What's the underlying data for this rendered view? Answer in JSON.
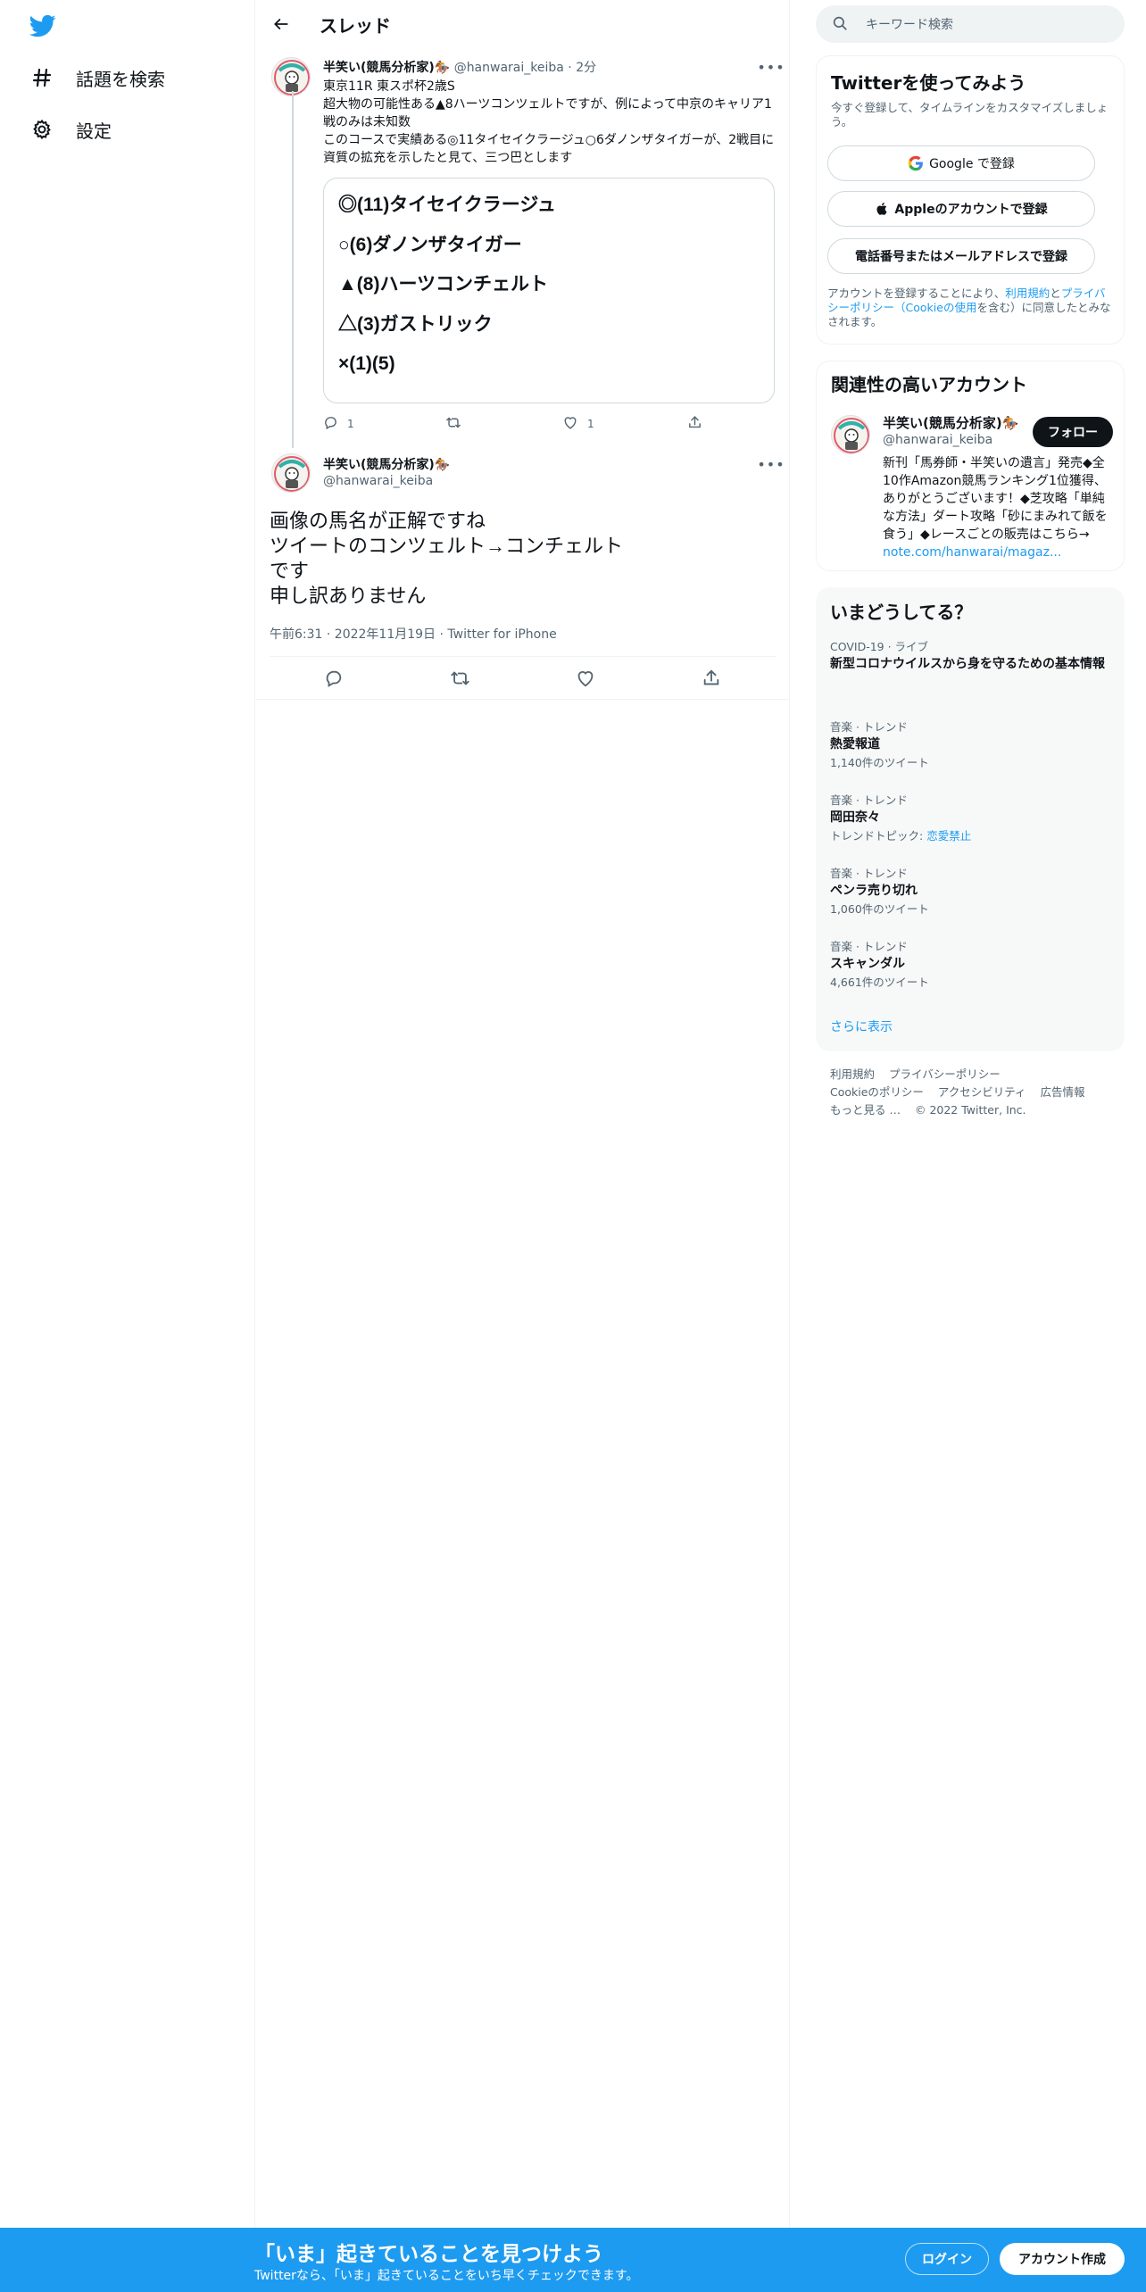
{
  "nav": {
    "explore_label": "話題を検索",
    "settings_label": "設定"
  },
  "thread": {
    "title": "スレッド",
    "tweet1": {
      "name": "半笑い(競馬分析家)🏇",
      "handle": "@hanwarai_keiba",
      "time": "· 2分",
      "text_lines": [
        "東京11R 東スポ杯2歳S",
        "超大物の可能性ある▲8ハーツコンツェルトですが、例によって中京のキャリア1戦のみは未知数",
        "このコースで実績ある◎11タイセイクラージュ○6ダノンザタイガーが、2戦目に資質の拡充を示したと見て、三つ巴とします"
      ],
      "card_lines": [
        "◎(11)タイセイクラージュ",
        "○(6)ダノンザタイガー",
        "▲(8)ハーツコンチェルト",
        "△(3)ガストリック",
        "×(1)(5)"
      ],
      "reply_count": "1",
      "like_count": "1"
    },
    "tweet2": {
      "name": "半笑い(競馬分析家)🏇",
      "handle": "@hanwarai_keiba",
      "text_lines": [
        "画像の馬名が正解ですね",
        "ツイートのコンツェルト→コンチェルト",
        "です",
        "申し訳ありません"
      ],
      "meta": "午前6:31 · 2022年11月19日 · Twitter for iPhone"
    }
  },
  "search": {
    "placeholder": "キーワード検索"
  },
  "signup_panel": {
    "title": "Twitterを使ってみよう",
    "subtitle": "今すぐ登録して、タイムラインをカスタマイズしましょう。",
    "google_label": "Google で登録",
    "apple_label": "Appleのアカウントで登録",
    "phone_label": "電話番号またはメールアドレスで登録",
    "legal_prefix": "アカウントを登録することにより、",
    "legal_terms": "利用規約",
    "legal_and": "と",
    "legal_privacy": "プライバシーポリシー",
    "legal_open": "（",
    "legal_cookie": "Cookieの使用",
    "legal_suffix": "を含む）に同意したとみなされます。"
  },
  "related_panel": {
    "title": "関連性の高いアカウント",
    "name": "半笑い(競馬分析家)🏇",
    "handle": "@hanwarai_keiba",
    "follow_label": "フォロー",
    "bio": "新刊「馬券師・半笑いの遺言」発売◆全10作Amazon競馬ランキング1位獲得、ありがとうございます！◆芝攻略「単純な方法」ダート攻略「砂にまみれて飯を食う」◆レースごとの販売はこちら→ ",
    "bio_link": "note.com/hanwarai/magaz..."
  },
  "trends_panel": {
    "title": "いまどうしてる？",
    "items": [
      {
        "category": "COVID-19 · ライブ",
        "title": "新型コロナウイルスから身を守るための基本情報",
        "count": ""
      },
      {
        "category": "音楽 · トレンド",
        "title": "熱愛報道",
        "count": "1,140件のツイート"
      },
      {
        "category": "音楽 · トレンド",
        "title": "岡田奈々",
        "count_prefix": "トレンドトピック: ",
        "count_link": "恋愛禁止"
      },
      {
        "category": "音楽 · トレンド",
        "title": "ペンラ売り切れ",
        "count": "1,060件のツイート"
      },
      {
        "category": "音楽 · トレンド",
        "title": "スキャンダル",
        "count": "4,661件のツイート"
      }
    ],
    "show_more": "さらに表示"
  },
  "footer": {
    "links": [
      "利用規約",
      "プライバシーポリシー",
      "Cookieのポリシー",
      "アクセシビリティ",
      "広告情報",
      "もっと見る …",
      "© 2022 Twitter, Inc."
    ]
  },
  "bottom_bar": {
    "title": "「いま」起きていることを見つけよう",
    "subtitle": "Twitterなら、「いま」起きていることをいち早くチェックできます。",
    "login_label": "ログイン",
    "signup_label": "アカウント作成"
  },
  "colors": {
    "brand": "#1d9bf0",
    "text": "#0f1419",
    "secondary": "#536471"
  }
}
